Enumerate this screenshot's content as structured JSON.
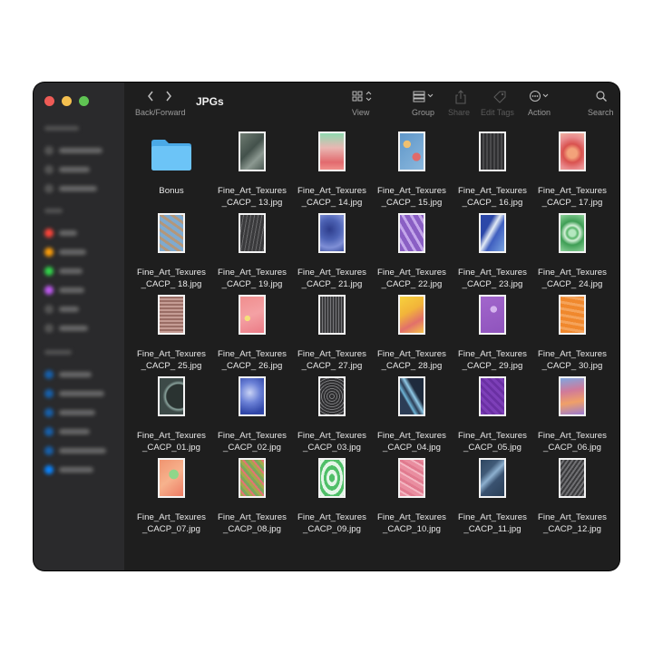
{
  "window": {
    "title": "JPGs",
    "traffic_lights": [
      "#ee5b56",
      "#f4bf4f",
      "#5fc453"
    ]
  },
  "toolbar": {
    "back_forward_label": "Back/Forward",
    "view_label": "View",
    "group_label": "Group",
    "share_label": "Share",
    "edit_tags_label": "Edit Tags",
    "action_label": "Action",
    "search_label": "Search",
    "icons": [
      "chevron-left-icon",
      "chevron-right-icon",
      "grid-view-icon",
      "group-icon",
      "share-icon",
      "tag-icon",
      "action-ellipsis-icon",
      "search-icon"
    ]
  },
  "sidebar": {
    "tag_colors": [
      "#ff453a",
      "#ff9f0a",
      "#32d74b",
      "#bf5af2"
    ],
    "location_color": "#0a84ff"
  },
  "files": [
    {
      "name": "Bonus",
      "kind": "folder",
      "color": "#5ab9f0"
    },
    {
      "name": "Fine_Art_Texures\n_CACP_ 13.jpg",
      "kind": "image",
      "color": "#6f7c72"
    },
    {
      "name": "Fine_Art_Texures\n_CACP_ 14.jpg",
      "kind": "image",
      "color": "#e38c8c"
    },
    {
      "name": "Fine_Art_Texures\n_CACP_ 15.jpg",
      "kind": "image",
      "color": "#5f97c9"
    },
    {
      "name": "Fine_Art_Texures\n_CACP_ 16.jpg",
      "kind": "image",
      "color": "#3a3a3c"
    },
    {
      "name": "Fine_Art_Texures\n_CACP_ 17.jpg",
      "kind": "image",
      "color": "#e57b6d"
    },
    {
      "name": "Fine_Art_Texures\n_CACP_ 18.jpg",
      "kind": "image",
      "color": "#7eaad0"
    },
    {
      "name": "Fine_Art_Texures\n_CACP_ 19.jpg",
      "kind": "image",
      "color": "#4a4a4c"
    },
    {
      "name": "Fine_Art_Texures\n_CACP_ 21.jpg",
      "kind": "image",
      "color": "#4d63b5"
    },
    {
      "name": "Fine_Art_Texures\n_CACP_ 22.jpg",
      "kind": "image",
      "color": "#9a72cf"
    },
    {
      "name": "Fine_Art_Texures\n_CACP_ 23.jpg",
      "kind": "image",
      "color": "#3f5fc0"
    },
    {
      "name": "Fine_Art_Texures\n_CACP_ 24.jpg",
      "kind": "image",
      "color": "#56b468"
    },
    {
      "name": "Fine_Art_Texures\n_CACP_ 25.jpg",
      "kind": "image",
      "color": "#b88f86"
    },
    {
      "name": "Fine_Art_Texures\n_CACP_ 26.jpg",
      "kind": "image",
      "color": "#f08e8e"
    },
    {
      "name": "Fine_Art_Texures\n_CACP_ 27.jpg",
      "kind": "image",
      "color": "#4f4f50"
    },
    {
      "name": "Fine_Art_Texures\n_CACP_ 28.jpg",
      "kind": "image",
      "color": "#f2b43a"
    },
    {
      "name": "Fine_Art_Texures\n_CACP_ 29.jpg",
      "kind": "image",
      "color": "#a266cc"
    },
    {
      "name": "Fine_Art_Texures\n_CACP_ 30.jpg",
      "kind": "image",
      "color": "#f0882d"
    },
    {
      "name": "Fine_Art_Texures\n_CACP_01.jpg",
      "kind": "image",
      "color": "#3d4a48"
    },
    {
      "name": "Fine_Art_Texures\n_CACP_02.jpg",
      "kind": "image",
      "color": "#6a80d6"
    },
    {
      "name": "Fine_Art_Texures\n_CACP_03.jpg",
      "kind": "image",
      "color": "#3e3e40"
    },
    {
      "name": "Fine_Art_Texures\n_CACP_04.jpg",
      "kind": "image",
      "color": "#2c3d55"
    },
    {
      "name": "Fine_Art_Texures\n_CACP_05.jpg",
      "kind": "image",
      "color": "#7d3fb8"
    },
    {
      "name": "Fine_Art_Texures\n_CACP_06.jpg",
      "kind": "image",
      "color": "#d07a9a"
    },
    {
      "name": "Fine_Art_Texures\n_CACP_07.jpg",
      "kind": "image",
      "color": "#f09470"
    },
    {
      "name": "Fine_Art_Texures\n_CACP_08.jpg",
      "kind": "image",
      "color": "#a4a94c"
    },
    {
      "name": "Fine_Art_Texures\n_CACP_09.jpg",
      "kind": "image",
      "color": "#4fbf68"
    },
    {
      "name": "Fine_Art_Texures\n_CACP_10.jpg",
      "kind": "image",
      "color": "#e98ea0"
    },
    {
      "name": "Fine_Art_Texures\n_CACP_11.jpg",
      "kind": "image",
      "color": "#415b78"
    },
    {
      "name": "Fine_Art_Texures\n_CACP_12.jpg",
      "kind": "image",
      "color": "#4c4c4e"
    }
  ]
}
